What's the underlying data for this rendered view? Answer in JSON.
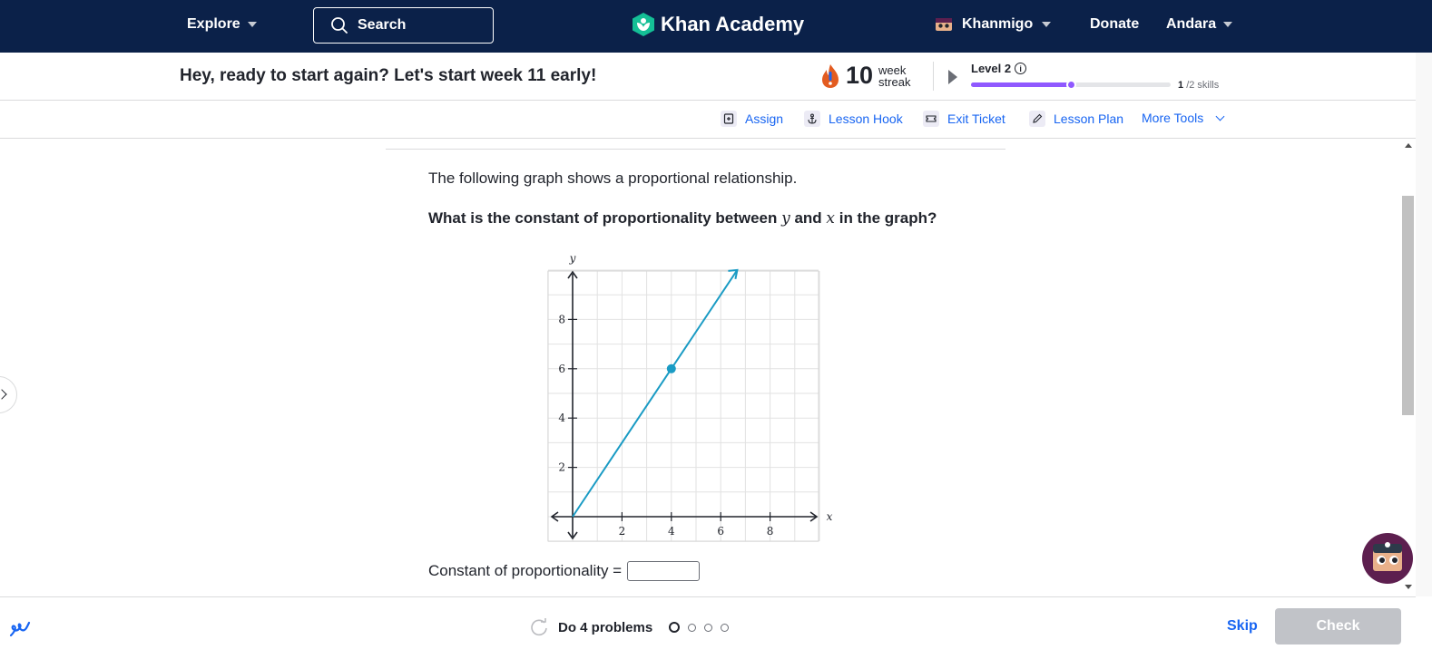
{
  "nav": {
    "explore": "Explore",
    "search": "Search",
    "brand": "Khan Academy",
    "khanmigo": "Khanmigo",
    "donate": "Donate",
    "user": "Andara",
    "bg_color": "#0b2149"
  },
  "greeting": {
    "text": "Hey, ready to start again? Let's start week 11 early!",
    "streak_count": "10",
    "streak_unit_1": "week",
    "streak_unit_2": "streak",
    "level": "Level 2",
    "level_progress": 0.5,
    "skills_done": "1",
    "skills_total": "/2 skills"
  },
  "tools": {
    "assign": "Assign",
    "lesson_hook": "Lesson Hook",
    "exit_ticket": "Exit Ticket",
    "lesson_plan": "Lesson Plan",
    "more_tools": "More Tools"
  },
  "question": {
    "intro": "The following graph shows a proportional relationship.",
    "prompt_pre": "What is the constant of proportionality between ",
    "var_y": "y",
    "prompt_mid": " and ",
    "var_x": "x",
    "prompt_post": " in the graph?",
    "answer_label": "Constant of proportionality ="
  },
  "graph": {
    "x_label": "x",
    "y_label": "y",
    "x_ticks": [
      "2",
      "4",
      "6",
      "8"
    ],
    "y_ticks": [
      "2",
      "4",
      "6",
      "8"
    ],
    "line_color": "#1fab54",
    "point": {
      "x": 4,
      "y": 6
    },
    "x_range": [
      -1,
      10
    ],
    "y_range": [
      -1,
      10
    ]
  },
  "footer": {
    "progress_text": "Do 4 problems",
    "problem_count": 4,
    "skip": "Skip",
    "check": "Check"
  }
}
